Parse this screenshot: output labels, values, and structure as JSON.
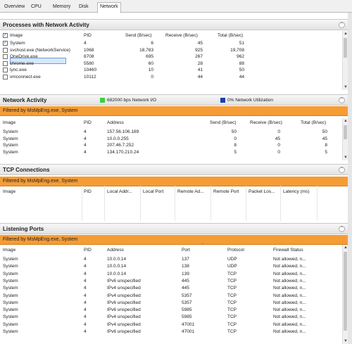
{
  "tabs": [
    {
      "label": "Overview"
    },
    {
      "label": "CPU"
    },
    {
      "label": "Memory"
    },
    {
      "label": "Disk"
    },
    {
      "label": "Network"
    }
  ],
  "processes": {
    "title": "Processes with Network Activity",
    "columns": [
      "Image",
      "PID",
      "Send (B/sec)",
      "Receive (B/sec)",
      "Total (B/sec)"
    ],
    "rows": [
      {
        "checked": true,
        "image": "System",
        "pid": "4",
        "send": "6",
        "receive": "45",
        "total": "51"
      },
      {
        "checked": false,
        "image": "svchost.exe (NetworkService)",
        "pid": "1068",
        "send": "18,783",
        "receive": "925",
        "total": "19,708"
      },
      {
        "checked": false,
        "image": "OneDrive.exe",
        "pid": "8708",
        "send": "695",
        "receive": "267",
        "total": "962"
      },
      {
        "checked": false,
        "image": "chrome.exe",
        "pid": "5580",
        "send": "60",
        "receive": "28",
        "total": "88"
      },
      {
        "checked": false,
        "image": "lync.exe",
        "pid": "10460",
        "send": "10",
        "receive": "41",
        "total": "50"
      },
      {
        "checked": false,
        "image": "vmconnect.exe",
        "pid": "10112",
        "send": "0",
        "receive": "44",
        "total": "44"
      }
    ]
  },
  "network_activity": {
    "title": "Network Activity",
    "legend_io": "682000 bps Network I/O",
    "legend_util": "0% Network Utilization",
    "io_color": "#3cd23c",
    "util_color": "#1a3fb0",
    "filter": "Filtered by MsMpEng.exe, System",
    "columns": [
      "Image",
      "PID",
      "Address",
      "Send (B/sec)",
      "Receive (B/sec)",
      "Total (B/sec)"
    ],
    "rows": [
      {
        "image": "System",
        "pid": "4",
        "address": "157.56.106.189",
        "send": "50",
        "receive": "0",
        "total": "50"
      },
      {
        "image": "System",
        "pid": "4",
        "address": "10.0.0.255",
        "send": "0",
        "receive": "45",
        "total": "45"
      },
      {
        "image": "System",
        "pid": "4",
        "address": "207.46.7.252",
        "send": "8",
        "receive": "0",
        "total": "8"
      },
      {
        "image": "System",
        "pid": "4",
        "address": "134.170.210.24",
        "send": "5",
        "receive": "0",
        "total": "5"
      }
    ]
  },
  "tcp": {
    "title": "TCP Connections",
    "filter": "Filtered by MsMpEng.exe, System",
    "columns": [
      "Image",
      "PID",
      "Local Addr...",
      "Local Port",
      "Remote Ad...",
      "Remote Port",
      "Packet Los...",
      "Latency (ms)"
    ]
  },
  "listening": {
    "title": "Listening Ports",
    "filter": "Filtered by MsMpEng.exe, System",
    "columns": [
      "Image",
      "PID",
      "Address",
      "Port",
      "Protocol",
      "Firewall Status"
    ],
    "rows": [
      {
        "image": "System",
        "pid": "4",
        "address": "10.0.0.14",
        "port": "137",
        "protocol": "UDP",
        "firewall": "Not allowed, n..."
      },
      {
        "image": "System",
        "pid": "4",
        "address": "10.0.0.14",
        "port": "138",
        "protocol": "UDP",
        "firewall": "Not allowed, n..."
      },
      {
        "image": "System",
        "pid": "4",
        "address": "10.0.0.14",
        "port": "139",
        "protocol": "TCP",
        "firewall": "Not allowed, n..."
      },
      {
        "image": "System",
        "pid": "4",
        "address": "IPv6 unspecified",
        "port": "445",
        "protocol": "TCP",
        "firewall": "Not allowed, n..."
      },
      {
        "image": "System",
        "pid": "4",
        "address": "IPv4 unspecified",
        "port": "445",
        "protocol": "TCP",
        "firewall": "Not allowed, n..."
      },
      {
        "image": "System",
        "pid": "4",
        "address": "IPv4 unspecified",
        "port": "5357",
        "protocol": "TCP",
        "firewall": "Not allowed, n..."
      },
      {
        "image": "System",
        "pid": "4",
        "address": "IPv6 unspecified",
        "port": "5357",
        "protocol": "TCP",
        "firewall": "Not allowed, n..."
      },
      {
        "image": "System",
        "pid": "4",
        "address": "IPv6 unspecified",
        "port": "5985",
        "protocol": "TCP",
        "firewall": "Not allowed, n..."
      },
      {
        "image": "System",
        "pid": "4",
        "address": "IPv4 unspecified",
        "port": "5985",
        "protocol": "TCP",
        "firewall": "Not allowed, n..."
      },
      {
        "image": "System",
        "pid": "4",
        "address": "IPv4 unspecified",
        "port": "47001",
        "protocol": "TCP",
        "firewall": "Not allowed, n..."
      },
      {
        "image": "System",
        "pid": "4",
        "address": "IPv6 unspecified",
        "port": "47001",
        "protocol": "TCP",
        "firewall": "Not allowed, n..."
      }
    ]
  },
  "icons": {
    "collapse": "chevron-up-icon",
    "scroll_up": "scroll-up-arrow-icon",
    "scroll_down": "scroll-down-arrow-icon"
  }
}
